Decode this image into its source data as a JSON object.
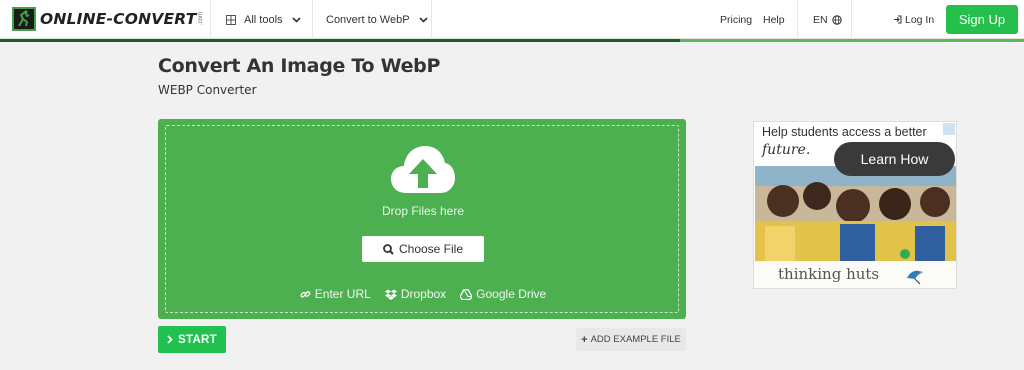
{
  "header": {
    "logo_text": "ONLINE-CONVERT",
    "logo_com": ".com",
    "all_tools": "All tools",
    "convert_menu": "Convert to WebP",
    "pricing": "Pricing",
    "help": "Help",
    "language": "EN",
    "login": "Log In",
    "signup": "Sign Up"
  },
  "page": {
    "title": "Convert An Image To WebP",
    "subtitle": "WEBP Converter"
  },
  "dropzone": {
    "drop_text": "Drop Files here",
    "choose_file": "Choose File",
    "sources": {
      "url": "Enter URL",
      "dropbox": "Dropbox",
      "gdrive": "Google Drive"
    }
  },
  "actions": {
    "start": "START",
    "add_example": "ADD EXAMPLE FILE"
  },
  "ad": {
    "line1": "Help students access a better",
    "line2": "future.",
    "cta": "Learn How",
    "brand": "thinking huts"
  },
  "colors": {
    "brand_green": "#4caf50",
    "cta_green": "#25c04b",
    "signup_green": "#25c04b"
  }
}
